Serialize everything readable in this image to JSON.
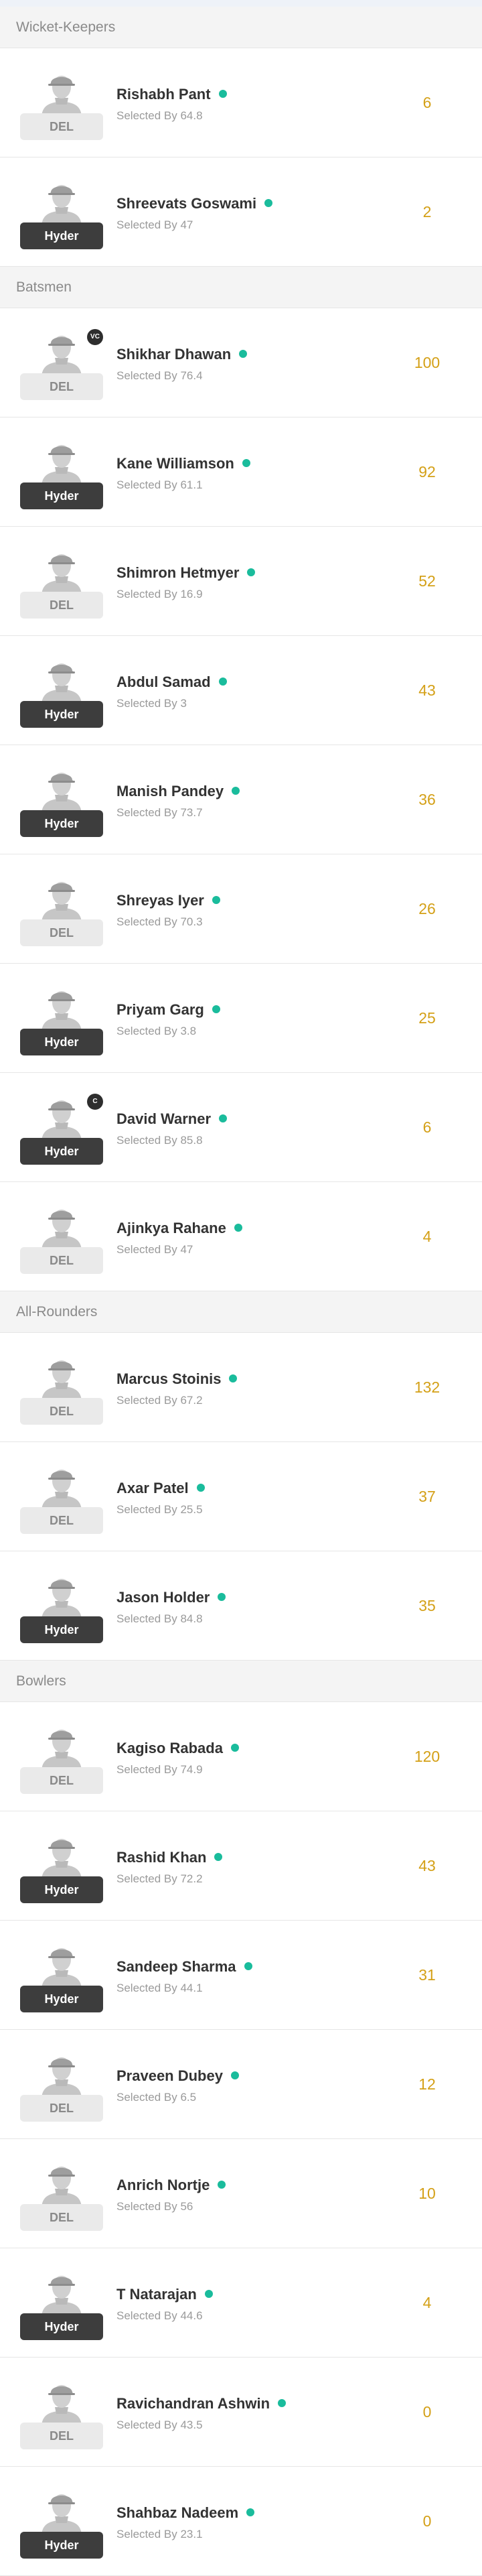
{
  "colors": {
    "accent_points": "#d4a017",
    "selected_dot": "#1abc9c",
    "badge_dark": "#3d3d3d",
    "badge_light": "#eaeaea"
  },
  "sections": [
    {
      "title": "Wicket-Keepers",
      "players": [
        {
          "name": "Rishabh Pant",
          "selected": "Selected By 64.8",
          "team": "DEL",
          "team_style": "light",
          "role": "",
          "points": "6"
        },
        {
          "name": "Shreevats Goswami",
          "selected": "Selected By 47",
          "team": "Hyder",
          "team_style": "dark",
          "role": "",
          "points": "2"
        }
      ]
    },
    {
      "title": "Batsmen",
      "players": [
        {
          "name": "Shikhar Dhawan",
          "selected": "Selected By 76.4",
          "team": "DEL",
          "team_style": "light",
          "role": "VC",
          "points": "100"
        },
        {
          "name": "Kane Williamson",
          "selected": "Selected By 61.1",
          "team": "Hyder",
          "team_style": "dark",
          "role": "",
          "points": "92"
        },
        {
          "name": "Shimron Hetmyer",
          "selected": "Selected By 16.9",
          "team": "DEL",
          "team_style": "light",
          "role": "",
          "points": "52"
        },
        {
          "name": "Abdul Samad",
          "selected": "Selected By 3",
          "team": "Hyder",
          "team_style": "dark",
          "role": "",
          "points": "43"
        },
        {
          "name": "Manish Pandey",
          "selected": "Selected By 73.7",
          "team": "Hyder",
          "team_style": "dark",
          "role": "",
          "points": "36"
        },
        {
          "name": "Shreyas Iyer",
          "selected": "Selected By 70.3",
          "team": "DEL",
          "team_style": "light",
          "role": "",
          "points": "26"
        },
        {
          "name": "Priyam Garg",
          "selected": "Selected By 3.8",
          "team": "Hyder",
          "team_style": "dark",
          "role": "",
          "points": "25"
        },
        {
          "name": "David Warner",
          "selected": "Selected By 85.8",
          "team": "Hyder",
          "team_style": "dark",
          "role": "C",
          "points": "6"
        },
        {
          "name": "Ajinkya Rahane",
          "selected": "Selected By 47",
          "team": "DEL",
          "team_style": "light",
          "role": "",
          "points": "4"
        }
      ]
    },
    {
      "title": "All-Rounders",
      "players": [
        {
          "name": "Marcus Stoinis",
          "selected": "Selected By 67.2",
          "team": "DEL",
          "team_style": "light",
          "role": "",
          "points": "132"
        },
        {
          "name": "Axar Patel",
          "selected": "Selected By 25.5",
          "team": "DEL",
          "team_style": "light",
          "role": "",
          "points": "37"
        },
        {
          "name": "Jason Holder",
          "selected": "Selected By 84.8",
          "team": "Hyder",
          "team_style": "dark",
          "role": "",
          "points": "35"
        }
      ]
    },
    {
      "title": "Bowlers",
      "players": [
        {
          "name": "Kagiso Rabada",
          "selected": "Selected By 74.9",
          "team": "DEL",
          "team_style": "light",
          "role": "",
          "points": "120"
        },
        {
          "name": "Rashid Khan",
          "selected": "Selected By 72.2",
          "team": "Hyder",
          "team_style": "dark",
          "role": "",
          "points": "43"
        },
        {
          "name": "Sandeep Sharma",
          "selected": "Selected By 44.1",
          "team": "Hyder",
          "team_style": "dark",
          "role": "",
          "points": "31"
        },
        {
          "name": "Praveen Dubey",
          "selected": "Selected By 6.5",
          "team": "DEL",
          "team_style": "light",
          "role": "",
          "points": "12"
        },
        {
          "name": "Anrich Nortje",
          "selected": "Selected By 56",
          "team": "DEL",
          "team_style": "light",
          "role": "",
          "points": "10"
        },
        {
          "name": "T Natarajan",
          "selected": "Selected By 44.6",
          "team": "Hyder",
          "team_style": "dark",
          "role": "",
          "points": "4"
        },
        {
          "name": "Ravichandran Ashwin",
          "selected": "Selected By 43.5",
          "team": "DEL",
          "team_style": "light",
          "role": "",
          "points": "0"
        },
        {
          "name": "Shahbaz Nadeem",
          "selected": "Selected By 23.1",
          "team": "Hyder",
          "team_style": "dark",
          "role": "",
          "points": "0"
        }
      ]
    }
  ]
}
